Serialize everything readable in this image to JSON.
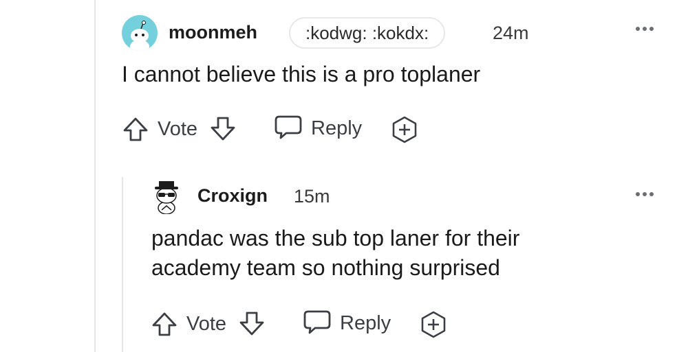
{
  "comments": [
    {
      "username": "moonmeh",
      "flair": ":kodwg: :kokdx:",
      "timestamp": "24m",
      "text": "I cannot believe this is a pro toplaner",
      "vote_label": "Vote",
      "reply_label": "Reply"
    },
    {
      "username": "Croxign",
      "timestamp": "15m",
      "text_lines": [
        "pandac was the sub top laner for their",
        "academy team so nothing surprised"
      ],
      "vote_label": "Vote",
      "reply_label": "Reply"
    }
  ],
  "icons": {
    "upvote": "arrow-up-outline-icon",
    "downvote": "arrow-down-outline-icon",
    "reply": "speech-bubble-icon",
    "award": "plus-badge-icon",
    "more": "ellipsis-icon"
  },
  "colors": {
    "text": "#1a1a1b",
    "muted": "#3b3f43",
    "avatar_bg": "#74d0dc",
    "thread_line": "#e4e6e8"
  }
}
